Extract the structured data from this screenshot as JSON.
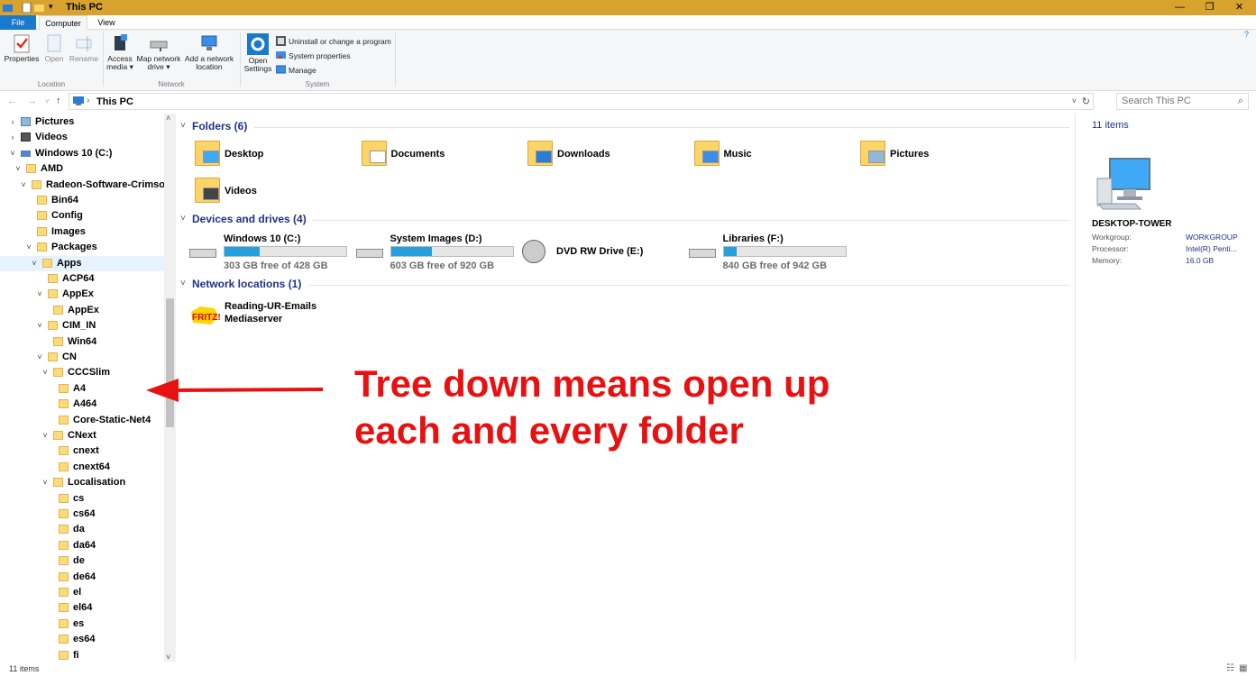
{
  "window": {
    "title": "This PC",
    "minimize": "—",
    "restore": "❐",
    "close": "✕"
  },
  "tabs": {
    "file": "File",
    "computer": "Computer",
    "view": "View"
  },
  "ribbon": {
    "location": {
      "properties": "Properties",
      "open": "Open",
      "rename": "Rename",
      "group": "Location"
    },
    "network": {
      "access_media_1": "Access",
      "access_media_2": "media ▾",
      "map_drive_1": "Map network",
      "map_drive_2": "drive ▾",
      "add_location_1": "Add a network",
      "add_location_2": "location",
      "group": "Network"
    },
    "system": {
      "open_settings_1": "Open",
      "open_settings_2": "Settings",
      "uninstall": "Uninstall or change a program",
      "system_properties": "System properties",
      "manage": "Manage",
      "group": "System"
    }
  },
  "address": {
    "path": "This PC",
    "search_placeholder": "Search This PC",
    "back": "←",
    "forward": "→",
    "up": "↑"
  },
  "tree": [
    {
      "label": "Pictures",
      "chev": "›",
      "indent": 0,
      "icon": "pictures"
    },
    {
      "label": "Videos",
      "chev": "›",
      "indent": 0,
      "icon": "videos"
    },
    {
      "label": "Windows 10 (C:)",
      "chev": "˅",
      "indent": 0,
      "icon": "drive"
    },
    {
      "label": "AMD",
      "chev": "˅",
      "indent": 1
    },
    {
      "label": "Radeon-Software-Crimson",
      "chev": "˅",
      "indent": 2
    },
    {
      "label": "Bin64",
      "chev": "",
      "indent": 3
    },
    {
      "label": "Config",
      "chev": "",
      "indent": 3
    },
    {
      "label": "Images",
      "chev": "",
      "indent": 3
    },
    {
      "label": "Packages",
      "chev": "˅",
      "indent": 3
    },
    {
      "label": "Apps",
      "chev": "˅",
      "indent": 4,
      "selected": true
    },
    {
      "label": "ACP64",
      "chev": "",
      "indent": 5
    },
    {
      "label": "AppEx",
      "chev": "˅",
      "indent": 5
    },
    {
      "label": "AppEx",
      "chev": "",
      "indent": 6
    },
    {
      "label": "CIM_IN",
      "chev": "˅",
      "indent": 5
    },
    {
      "label": "Win64",
      "chev": "",
      "indent": 6
    },
    {
      "label": "CN",
      "chev": "˅",
      "indent": 5
    },
    {
      "label": "CCCSlim",
      "chev": "˅",
      "indent": 6
    },
    {
      "label": "A4",
      "chev": "",
      "indent": 7
    },
    {
      "label": "A464",
      "chev": "",
      "indent": 7
    },
    {
      "label": "Core-Static-Net4",
      "chev": "",
      "indent": 7
    },
    {
      "label": "CNext",
      "chev": "˅",
      "indent": 6
    },
    {
      "label": "cnext",
      "chev": "",
      "indent": 7
    },
    {
      "label": "cnext64",
      "chev": "",
      "indent": 7
    },
    {
      "label": "Localisation",
      "chev": "˅",
      "indent": 6
    },
    {
      "label": "cs",
      "chev": "",
      "indent": 7
    },
    {
      "label": "cs64",
      "chev": "",
      "indent": 7
    },
    {
      "label": "da",
      "chev": "",
      "indent": 7
    },
    {
      "label": "da64",
      "chev": "",
      "indent": 7
    },
    {
      "label": "de",
      "chev": "",
      "indent": 7
    },
    {
      "label": "de64",
      "chev": "",
      "indent": 7
    },
    {
      "label": "el",
      "chev": "",
      "indent": 7
    },
    {
      "label": "el64",
      "chev": "",
      "indent": 7
    },
    {
      "label": "es",
      "chev": "",
      "indent": 7
    },
    {
      "label": "es64",
      "chev": "",
      "indent": 7
    },
    {
      "label": "fi",
      "chev": "",
      "indent": 7
    }
  ],
  "content": {
    "folders_header": "Folders (6)",
    "folders": [
      "Desktop",
      "Documents",
      "Downloads",
      "Music",
      "Pictures",
      "Videos"
    ],
    "drives_header": "Devices and drives (4)",
    "drives": [
      {
        "name": "Windows 10 (C:)",
        "free": "303 GB free of 428 GB",
        "used_fraction": 0.29
      },
      {
        "name": "System Images (D:)",
        "free": "603 GB free of 920 GB",
        "used_fraction": 0.34
      },
      {
        "name": "DVD RW Drive (E:)",
        "free": "",
        "used_fraction": null
      },
      {
        "name": "Libraries (F:)",
        "free": "840 GB free of 942 GB",
        "used_fraction": 0.11
      }
    ],
    "network_header": "Network locations (1)",
    "network_item_1": "Reading-UR-Emails",
    "network_item_2": "Mediaserver"
  },
  "details": {
    "count": "11 items",
    "computer_name": "DESKTOP-TOWER",
    "workgroup_label": "Workgroup:",
    "workgroup_value": "WORKGROUP",
    "processor_label": "Processor:",
    "processor_value": "Intel(R) Penti...",
    "memory_label": "Memory:",
    "memory_value": "16.0 GB"
  },
  "status": {
    "count": "11 items"
  },
  "annotation": {
    "line1": "Tree down means open up",
    "line2": "each and every folder"
  },
  "colors": {
    "titlebar": "#d7a32e",
    "accent": "#1979ca",
    "annotation": "#e81010",
    "section": "#1e3287",
    "bar_fill": "#26a0da"
  }
}
